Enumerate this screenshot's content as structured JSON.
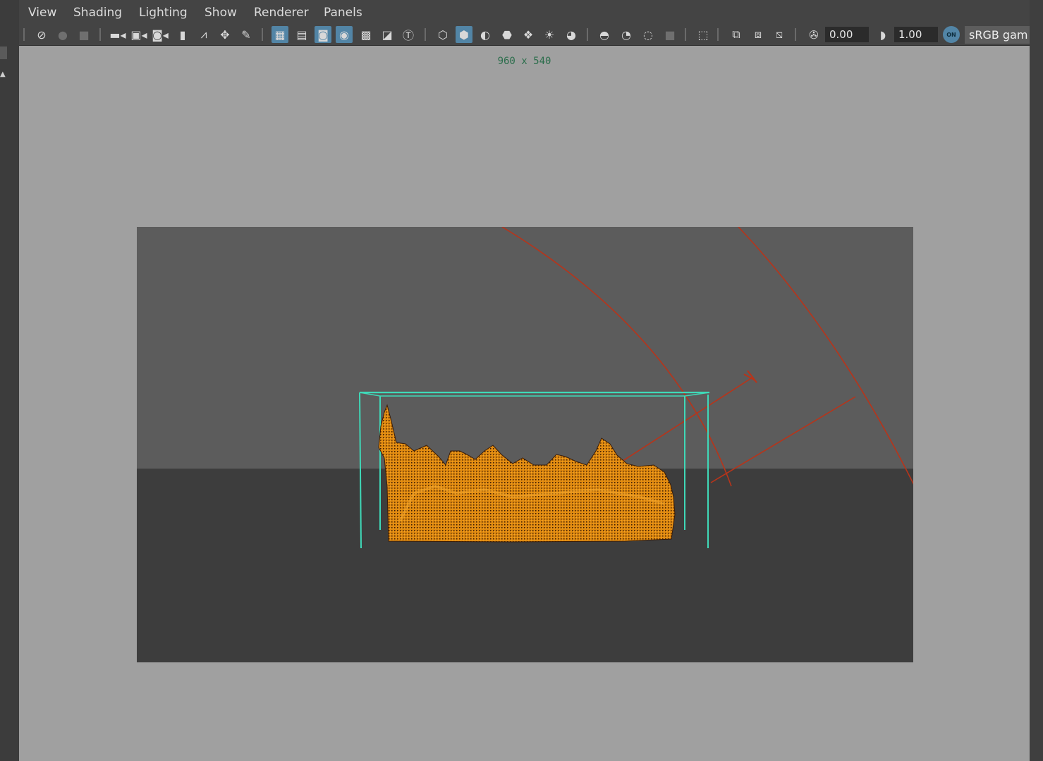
{
  "menubar": {
    "items": [
      "View",
      "Shading",
      "Lighting",
      "Show",
      "Renderer",
      "Panels"
    ]
  },
  "toolbar": {
    "icons": [
      "select-camera-icon",
      "lock-camera-icon",
      "camera-attributes-icon",
      "camera-icon",
      "bookmark-camera-icon",
      "film-gate-camera-icon",
      "bookmark-icon",
      "image-plane-icon",
      "grease-pencil-icon",
      "2d-pan-zoom-icon",
      "grid-icon",
      "film-gate-icon",
      "resolution-gate-icon",
      "gate-mask-icon",
      "field-chart-icon",
      "safe-action-icon",
      "safe-title-icon",
      "wireframe-icon",
      "smooth-shade-icon",
      "use-default-material-icon",
      "wireframe-on-shaded-icon",
      "xray-icon",
      "use-all-lights-icon",
      "shadows-icon",
      "screen-space-ambient-occlusion-icon",
      "motion-blur-icon",
      "multisample-aa-icon",
      "depth-of-field-icon",
      "isolate-select-icon",
      "xray-joints-icon",
      "xray-active-components-icon",
      "backface-culling-icon",
      "exposure-icon",
      "gamma-icon",
      "color-management-icon"
    ],
    "exposure_value": "0.00",
    "gamma_value": "1.00",
    "color_management_badge": "ON",
    "color_space": "sRGB gam"
  },
  "viewport": {
    "resolution_label": "960 x 540"
  },
  "colors": {
    "panel_background": "#a0a0a0",
    "sky": "#5c5c5c",
    "ground": "#3d3d3d",
    "fluid_container": "#3fd9b8",
    "light_manipulator": "#b8341a",
    "fire": "#e08a10",
    "active_button": "#5285a6"
  }
}
